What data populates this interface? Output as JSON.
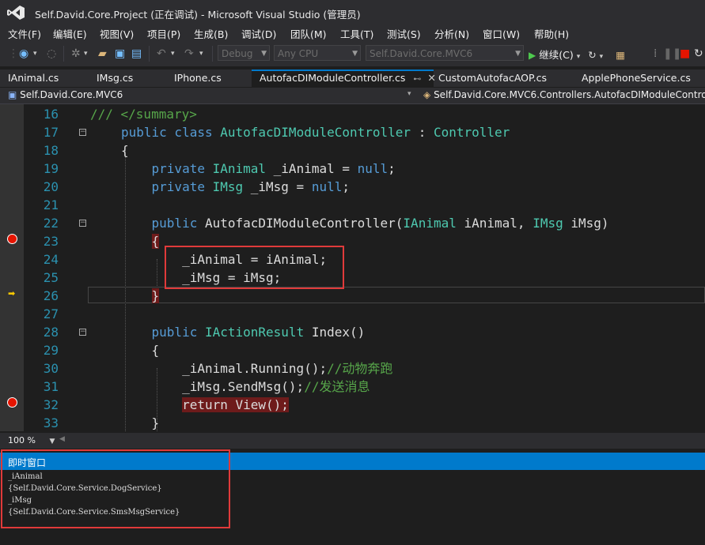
{
  "window": {
    "title": "Self.David.Core.Project (正在调试) - Microsoft Visual Studio (管理员)"
  },
  "menu": [
    "文件(F)",
    "编辑(E)",
    "视图(V)",
    "项目(P)",
    "生成(B)",
    "调试(D)",
    "团队(M)",
    "工具(T)",
    "测试(S)",
    "分析(N)",
    "窗口(W)",
    "帮助(H)"
  ],
  "toolbar": {
    "config": "Debug",
    "platform": "Any CPU",
    "project": "Self.David.Core.MVC6",
    "continue_label": "继续(C)"
  },
  "tabs": [
    "IAnimal.cs",
    "IMsg.cs",
    "IPhone.cs",
    "AutofacDIModuleController.cs",
    "CustomAutofacAOP.cs",
    "ApplePhoneService.cs"
  ],
  "active_tab": "AutofacDIModuleController.cs",
  "nav": {
    "project": "Self.David.Core.MVC6",
    "type": "Self.David.Core.MVC6.Controllers.AutofacDIModuleControl"
  },
  "code": {
    "lines": [
      {
        "n": "16",
        "tokens": [
          {
            "t": "/// </summary>",
            "c": "cm"
          }
        ]
      },
      {
        "n": "17",
        "tokens": [
          {
            "t": "public class ",
            "c": "kw"
          },
          {
            "t": "AutofacDIModuleController",
            "c": "ty"
          },
          {
            "t": " : ",
            "c": "pl"
          },
          {
            "t": "Controller",
            "c": "ty"
          }
        ]
      },
      {
        "n": "18",
        "tokens": [
          {
            "t": "{",
            "c": "pl"
          }
        ]
      },
      {
        "n": "19",
        "tokens": [
          {
            "t": "    private ",
            "c": "kw"
          },
          {
            "t": "IAnimal",
            "c": "ty"
          },
          {
            "t": " _iAnimal = ",
            "c": "pl"
          },
          {
            "t": "null",
            "c": "kw"
          },
          {
            "t": ";",
            "c": "pl"
          }
        ]
      },
      {
        "n": "20",
        "tokens": [
          {
            "t": "    private ",
            "c": "kw"
          },
          {
            "t": "IMsg",
            "c": "ty"
          },
          {
            "t": " _iMsg = ",
            "c": "pl"
          },
          {
            "t": "null",
            "c": "kw"
          },
          {
            "t": ";",
            "c": "pl"
          }
        ]
      },
      {
        "n": "21",
        "tokens": []
      },
      {
        "n": "22",
        "tokens": [
          {
            "t": "    public ",
            "c": "kw"
          },
          {
            "t": "AutofacDIModuleController(",
            "c": "pl"
          },
          {
            "t": "IAnimal",
            "c": "ty"
          },
          {
            "t": " iAnimal, ",
            "c": "pl"
          },
          {
            "t": "IMsg",
            "c": "ty"
          },
          {
            "t": " iMsg)",
            "c": "pl"
          }
        ]
      },
      {
        "n": "23",
        "tokens": [
          {
            "t": "    ",
            "c": "pl"
          },
          {
            "t": "{",
            "c": "pl hl-brace"
          }
        ]
      },
      {
        "n": "24",
        "tokens": [
          {
            "t": "        _iAnimal = iAnimal;",
            "c": "pl"
          }
        ]
      },
      {
        "n": "25",
        "tokens": [
          {
            "t": "        _iMsg = iMsg;",
            "c": "pl"
          }
        ]
      },
      {
        "n": "26",
        "tokens": [
          {
            "t": "    ",
            "c": "pl"
          },
          {
            "t": "}",
            "c": "pl hl-brace"
          }
        ]
      },
      {
        "n": "27",
        "tokens": []
      },
      {
        "n": "28",
        "tokens": [
          {
            "t": "    public ",
            "c": "kw"
          },
          {
            "t": "IActionResult",
            "c": "ty"
          },
          {
            "t": " Index()",
            "c": "pl"
          }
        ]
      },
      {
        "n": "29",
        "tokens": [
          {
            "t": "    {",
            "c": "pl"
          }
        ]
      },
      {
        "n": "30",
        "tokens": [
          {
            "t": "        _iAnimal.Running();",
            "c": "pl"
          },
          {
            "t": "//动物奔跑",
            "c": "cm"
          }
        ]
      },
      {
        "n": "31",
        "tokens": [
          {
            "t": "        _iMsg.SendMsg();",
            "c": "pl"
          },
          {
            "t": "//发送消息",
            "c": "cm"
          }
        ]
      },
      {
        "n": "32",
        "tokens": [
          {
            "t": "        ",
            "c": "pl"
          },
          {
            "t": "return View();",
            "c": "pl hl-brace"
          }
        ]
      },
      {
        "n": "33",
        "tokens": [
          {
            "t": "    }",
            "c": "pl"
          }
        ]
      }
    ]
  },
  "zoom": "100 %",
  "immediate": {
    "title": "即时窗口",
    "lines": [
      "_iAnimal",
      "{Self.David.Core.Service.DogService}",
      "_iMsg",
      "{Self.David.Core.Service.SmsMsgService}"
    ]
  }
}
